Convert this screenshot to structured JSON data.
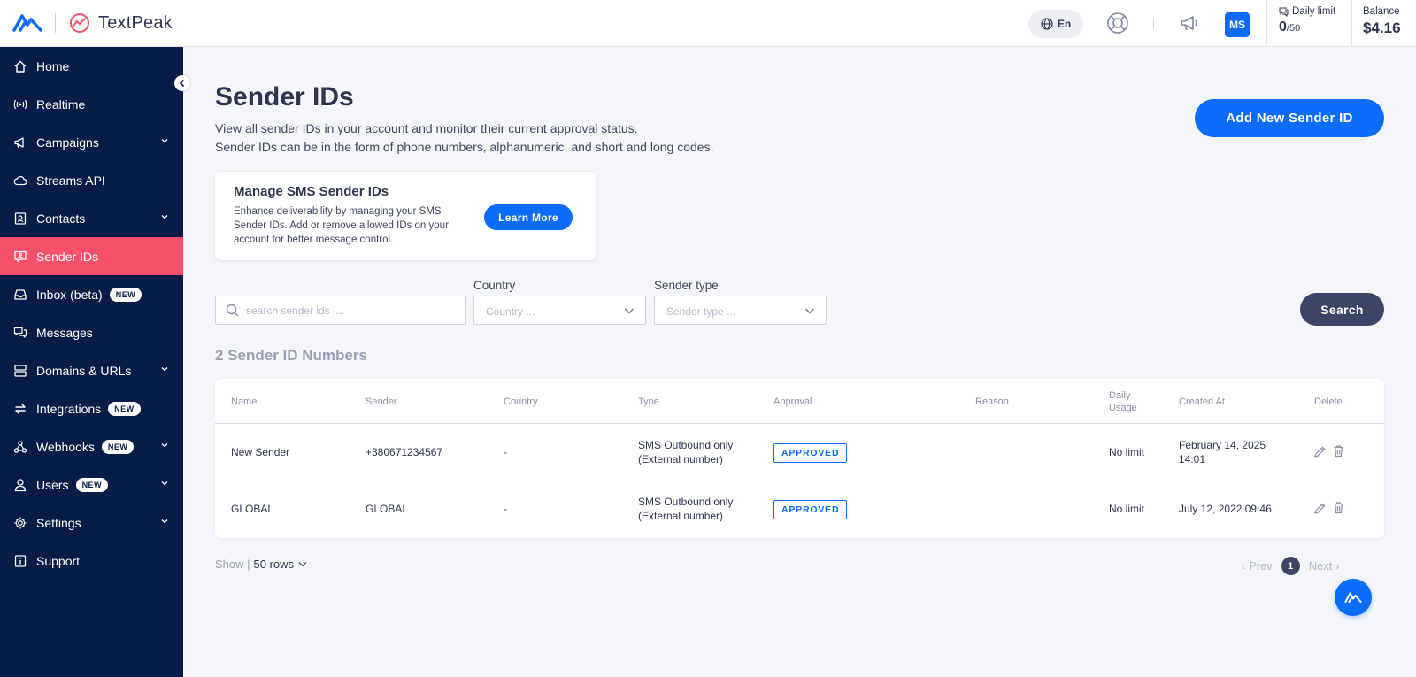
{
  "brand": {
    "name": "TextPeak"
  },
  "topbar": {
    "language": "En",
    "avatar_initials": "MS",
    "daily_limit": {
      "label": "Daily limit",
      "used": "0",
      "total": "/50"
    },
    "balance": {
      "label": "Balance",
      "value": "$4.16"
    }
  },
  "sidebar": {
    "items": [
      {
        "label": "Home",
        "icon": "home-icon"
      },
      {
        "label": "Realtime",
        "icon": "broadcast-icon"
      },
      {
        "label": "Campaigns",
        "icon": "megaphone-icon",
        "expandable": true
      },
      {
        "label": "Streams API",
        "icon": "cloud-icon"
      },
      {
        "label": "Contacts",
        "icon": "contacts-icon",
        "expandable": true
      },
      {
        "label": "Sender IDs",
        "icon": "sender-id-icon",
        "active": true
      },
      {
        "label": "Inbox (beta)",
        "icon": "inbox-icon",
        "badge": "NEW"
      },
      {
        "label": "Messages",
        "icon": "messages-icon"
      },
      {
        "label": "Domains & URLs",
        "icon": "server-icon",
        "expandable": true
      },
      {
        "label": "Integrations",
        "icon": "integrations-icon",
        "badge": "NEW"
      },
      {
        "label": "Webhooks",
        "icon": "webhook-icon",
        "badge": "NEW",
        "expandable": true
      },
      {
        "label": "Users",
        "icon": "user-icon",
        "badge": "NEW",
        "expandable": true
      },
      {
        "label": "Settings",
        "icon": "gear-icon",
        "expandable": true
      },
      {
        "label": "Support",
        "icon": "support-icon"
      }
    ]
  },
  "page": {
    "title": "Sender IDs",
    "description_line1": "View all sender IDs in your account and monitor their current approval status.",
    "description_line2": "Sender IDs can be in the form of phone numbers, alphanumeric, and short and long codes.",
    "add_button": "Add New Sender ID"
  },
  "promo": {
    "title": "Manage SMS Sender IDs",
    "description": "Enhance deliverability by managing your SMS Sender IDs. Add or remove allowed IDs on your account for better message control.",
    "button": "Learn More"
  },
  "filters": {
    "search_placeholder": "search sender ids  ...",
    "country_label": "Country",
    "country_placeholder": "Country ...",
    "sender_type_label": "Sender type",
    "sender_type_placeholder": "Sender type ...",
    "search_button": "Search"
  },
  "results": {
    "count_title": "2 Sender ID Numbers"
  },
  "table": {
    "headers": {
      "name": "Name",
      "sender": "Sender",
      "country": "Country",
      "type": "Type",
      "approval": "Approval",
      "reason": "Reason",
      "daily_usage_1": "Daily",
      "daily_usage_2": "Usage",
      "created_at": "Created At",
      "delete": "Delete"
    },
    "rows": [
      {
        "name": "New Sender",
        "sender": "+380671234567",
        "country": "-",
        "type_1": "SMS Outbound only",
        "type_2": "(External number)",
        "approval": "APPROVED",
        "reason": "",
        "daily_usage": "No limit",
        "created_1": "February 14, 2025",
        "created_2": "14:01"
      },
      {
        "name": "GLOBAL",
        "sender": "GLOBAL",
        "country": "-",
        "type_1": "SMS Outbound only",
        "type_2": "(External number)",
        "approval": "APPROVED",
        "reason": "",
        "daily_usage": "No limit",
        "created_1": "July 12, 2022 09:46",
        "created_2": ""
      }
    ]
  },
  "footer": {
    "show_label": "Show |",
    "rows_value": "50 rows",
    "prev": "Prev",
    "page": "1",
    "next": "Next"
  },
  "colors": {
    "sidebar_bg": "#071c47",
    "active_item": "#f7506a",
    "primary": "#0b6bfa",
    "dark_button": "#3c4566"
  }
}
